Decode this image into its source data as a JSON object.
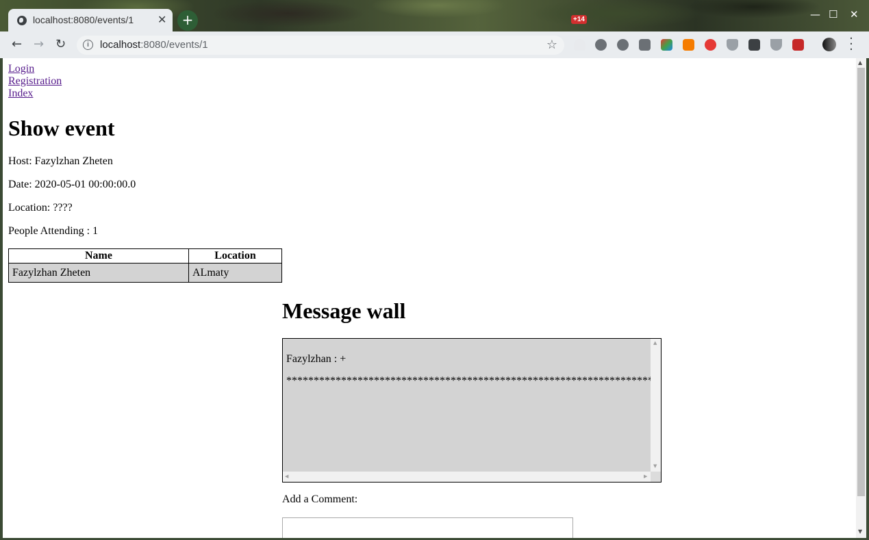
{
  "browser": {
    "tab_title": "localhost:8080/events/1",
    "tab_close": "✕",
    "new_tab": "+",
    "url_host": "localhost",
    "url_path": ":8080/events/1",
    "extension_badge": "+14",
    "window_controls": {
      "minimize": "—",
      "maximize": "☐",
      "close": "✕"
    },
    "nav": {
      "back": "←",
      "forward": "→",
      "reload": "↻"
    },
    "bookmark_icon": "☆"
  },
  "nav_links": [
    "Login",
    "Registration",
    "Index"
  ],
  "page_title": "Show event",
  "event": {
    "host": "Host: Fazylzhan Zheten",
    "date": "Date: 2020-05-01 00:00:00.0",
    "location": "Location: ????",
    "attending": "People Attending : 1"
  },
  "attendees_table": {
    "headers": [
      "Name",
      "Location"
    ],
    "rows": [
      [
        "Fazylzhan Zheten",
        "ALmaty"
      ]
    ]
  },
  "message_wall": {
    "title": "Message wall",
    "message": "Fazylzhan : +",
    "stars": "******************************************************************************"
  },
  "comment": {
    "label": "Add a Comment:",
    "value": ""
  },
  "colors": {
    "link_visited": "#551a8b",
    "cell_bg": "#d3d3d3",
    "wall_bg": "#d3d3d3"
  }
}
